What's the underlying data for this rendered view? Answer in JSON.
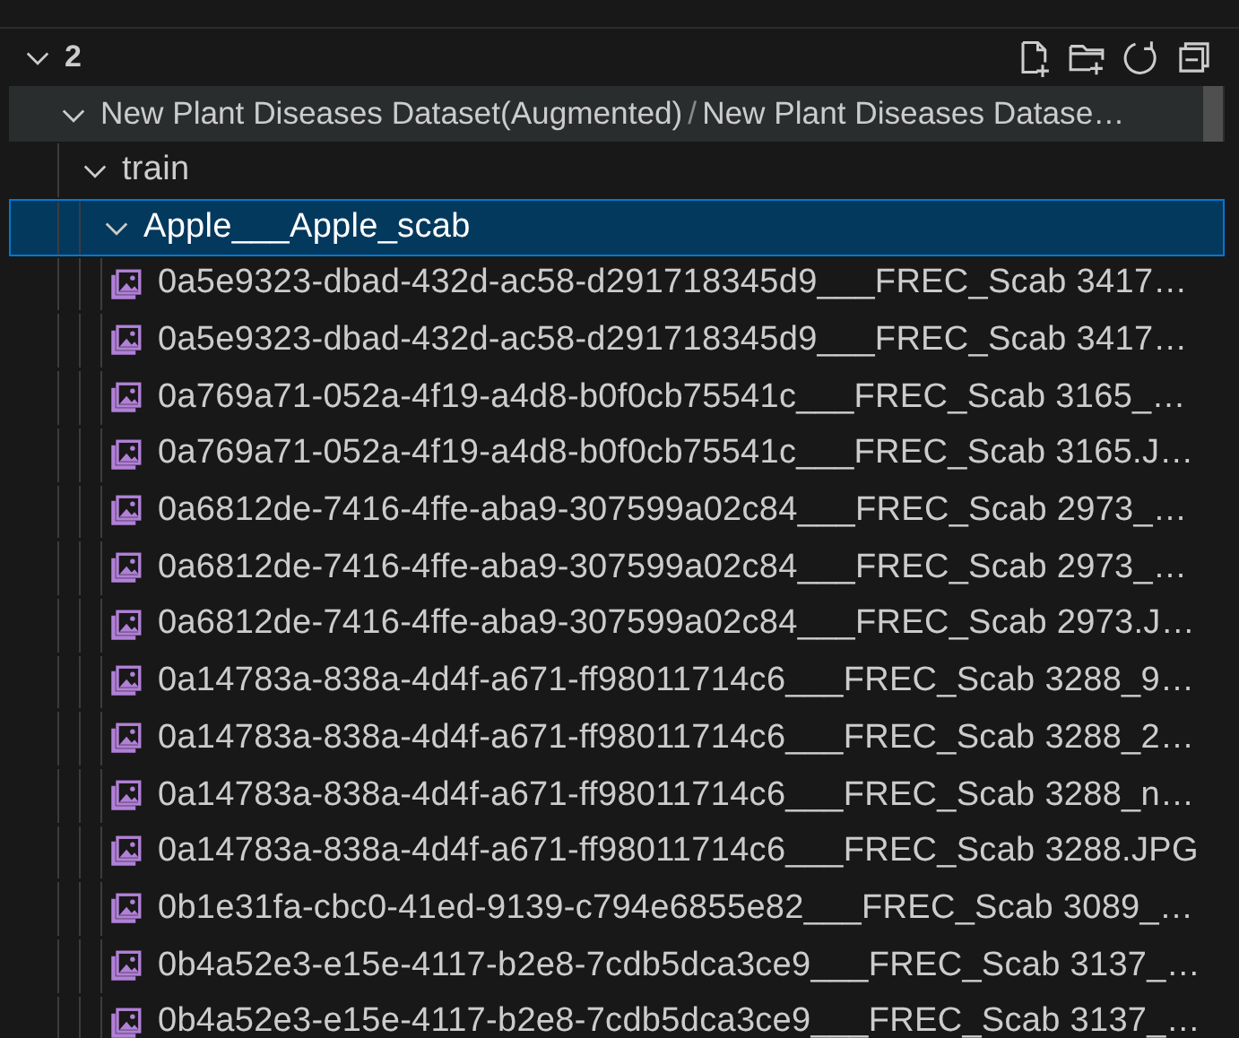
{
  "workspace": {
    "title": "2",
    "expanded": true,
    "actions": [
      {
        "kind": "new-file"
      },
      {
        "kind": "new-folder"
      },
      {
        "kind": "refresh"
      },
      {
        "kind": "collapse"
      }
    ]
  },
  "tree": [
    {
      "kind": "folder",
      "label": "New Plant Diseases Dataset(Augmented)",
      "separator": "/",
      "path_suffix": "New Plant Diseases Datase…",
      "expanded": true,
      "selected": false,
      "hovered": true,
      "children": [
        {
          "kind": "folder",
          "label": "train",
          "expanded": true,
          "selected": false,
          "children": [
            {
              "kind": "folder",
              "label": "Apple___Apple_scab",
              "expanded": true,
              "selected": true,
              "children": [
                {
                  "kind": "image",
                  "label": "0a5e9323-dbad-432d-ac58-d291718345d9___FREC_Scab 3417…",
                  "selected": false
                },
                {
                  "kind": "image",
                  "label": "0a5e9323-dbad-432d-ac58-d291718345d9___FREC_Scab 3417…",
                  "selected": false
                },
                {
                  "kind": "image",
                  "label": "0a769a71-052a-4f19-a4d8-b0f0cb75541c___FREC_Scab 3165_…",
                  "selected": false
                },
                {
                  "kind": "image",
                  "label": "0a769a71-052a-4f19-a4d8-b0f0cb75541c___FREC_Scab 3165.J…",
                  "selected": false
                },
                {
                  "kind": "image",
                  "label": "0a6812de-7416-4ffe-aba9-307599a02c84___FREC_Scab 2973_…",
                  "selected": false
                },
                {
                  "kind": "image",
                  "label": "0a6812de-7416-4ffe-aba9-307599a02c84___FREC_Scab 2973_…",
                  "selected": false
                },
                {
                  "kind": "image",
                  "label": "0a6812de-7416-4ffe-aba9-307599a02c84___FREC_Scab 2973.J…",
                  "selected": false
                },
                {
                  "kind": "image",
                  "label": "0a14783a-838a-4d4f-a671-ff98011714c6___FREC_Scab 3288_9…",
                  "selected": false
                },
                {
                  "kind": "image",
                  "label": "0a14783a-838a-4d4f-a671-ff98011714c6___FREC_Scab 3288_2…",
                  "selected": false
                },
                {
                  "kind": "image",
                  "label": "0a14783a-838a-4d4f-a671-ff98011714c6___FREC_Scab 3288_n…",
                  "selected": false
                },
                {
                  "kind": "image",
                  "label": "0a14783a-838a-4d4f-a671-ff98011714c6___FREC_Scab 3288.JPG",
                  "selected": false
                },
                {
                  "kind": "image",
                  "label": "0b1e31fa-cbc0-41ed-9139-c794e6855e82___FREC_Scab 3089_…",
                  "selected": false
                },
                {
                  "kind": "image",
                  "label": "0b4a52e3-e15e-4117-b2e8-7cdb5dca3ce9___FREC_Scab 3137_…",
                  "selected": false
                },
                {
                  "kind": "image",
                  "label": "0b4a52e3-e15e-4117-b2e8-7cdb5dca3ce9___FREC_Scab 3137_…",
                  "selected": false
                }
              ]
            }
          ]
        }
      ]
    }
  ]
}
